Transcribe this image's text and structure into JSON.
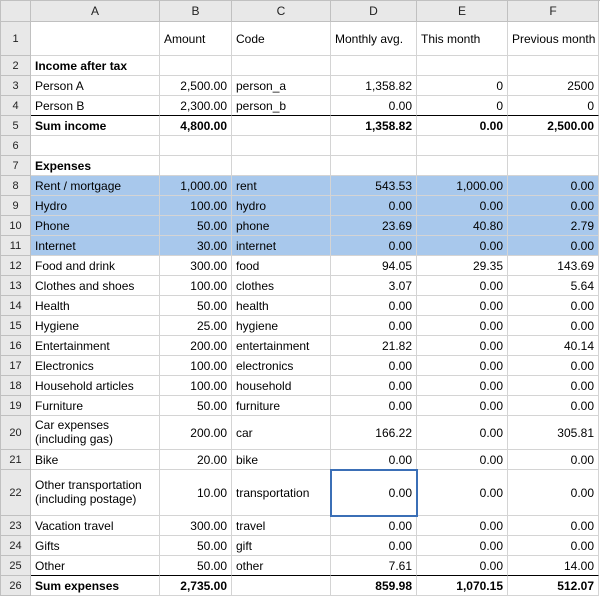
{
  "columns": [
    "",
    "A",
    "B",
    "C",
    "D",
    "E",
    "F"
  ],
  "row1": {
    "A": "",
    "B": "Amount",
    "C": "Code",
    "D": "Monthly avg.",
    "E": "This month",
    "F": "Previous month"
  },
  "rows": [
    {
      "n": "2",
      "A": "Income after tax",
      "B": "",
      "C": "",
      "D": "",
      "E": "",
      "F": "",
      "bold": true,
      "aBold": true
    },
    {
      "n": "3",
      "A": "Person A",
      "B": "2,500.00",
      "C": "person_a",
      "D": "1,358.82",
      "E": "0",
      "F": "2500"
    },
    {
      "n": "4",
      "A": "Person B",
      "B": "2,300.00",
      "C": "person_b",
      "D": "0.00",
      "E": "0",
      "F": "0",
      "bb": true
    },
    {
      "n": "5",
      "A": "Sum income",
      "B": "4,800.00",
      "C": "",
      "D": "1,358.82",
      "E": "0.00",
      "F": "2,500.00",
      "bold": true,
      "aBold": true
    },
    {
      "n": "6",
      "A": "",
      "B": "",
      "C": "",
      "D": "",
      "E": "",
      "F": ""
    },
    {
      "n": "7",
      "A": "Expenses",
      "B": "",
      "C": "",
      "D": "",
      "E": "",
      "F": "",
      "aBold": true
    },
    {
      "n": "8",
      "A": "Rent / mortgage",
      "B": "1,000.00",
      "C": "rent",
      "D": "543.53",
      "E": "1,000.00",
      "F": "0.00",
      "sel": true
    },
    {
      "n": "9",
      "A": "Hydro",
      "B": "100.00",
      "C": "hydro",
      "D": "0.00",
      "E": "0.00",
      "F": "0.00",
      "sel": true
    },
    {
      "n": "10",
      "A": "Phone",
      "B": "50.00",
      "C": "phone",
      "D": "23.69",
      "E": "40.80",
      "F": "2.79",
      "sel": true
    },
    {
      "n": "11",
      "A": "Internet",
      "B": "30.00",
      "C": "internet",
      "D": "0.00",
      "E": "0.00",
      "F": "0.00",
      "sel": true
    },
    {
      "n": "12",
      "A": "Food and drink",
      "B": "300.00",
      "C": "food",
      "D": "94.05",
      "E": "29.35",
      "F": "143.69"
    },
    {
      "n": "13",
      "A": "Clothes and shoes",
      "B": "100.00",
      "C": "clothes",
      "D": "3.07",
      "E": "0.00",
      "F": "5.64"
    },
    {
      "n": "14",
      "A": "Health",
      "B": "50.00",
      "C": "health",
      "D": "0.00",
      "E": "0.00",
      "F": "0.00"
    },
    {
      "n": "15",
      "A": "Hygiene",
      "B": "25.00",
      "C": "hygiene",
      "D": "0.00",
      "E": "0.00",
      "F": "0.00"
    },
    {
      "n": "16",
      "A": "Entertainment",
      "B": "200.00",
      "C": "entertainment",
      "D": "21.82",
      "E": "0.00",
      "F": "40.14"
    },
    {
      "n": "17",
      "A": "Electronics",
      "B": "100.00",
      "C": "electronics",
      "D": "0.00",
      "E": "0.00",
      "F": "0.00"
    },
    {
      "n": "18",
      "A": "Household articles",
      "B": "100.00",
      "C": "household",
      "D": "0.00",
      "E": "0.00",
      "F": "0.00"
    },
    {
      "n": "19",
      "A": "Furniture",
      "B": "50.00",
      "C": "furniture",
      "D": "0.00",
      "E": "0.00",
      "F": "0.00"
    },
    {
      "n": "20",
      "A": "Car expenses (including gas)",
      "B": "200.00",
      "C": "car",
      "D": "166.22",
      "E": "0.00",
      "F": "305.81",
      "tall": 1
    },
    {
      "n": "21",
      "A": "Bike",
      "B": "20.00",
      "C": "bike",
      "D": "0.00",
      "E": "0.00",
      "F": "0.00"
    },
    {
      "n": "22",
      "A": "Other transportation (including postage)",
      "B": "10.00",
      "C": "transportation",
      "D": "0.00",
      "E": "0.00",
      "F": "0.00",
      "tall": 2,
      "activeD": true
    },
    {
      "n": "23",
      "A": "Vacation travel",
      "B": "300.00",
      "C": "travel",
      "D": "0.00",
      "E": "0.00",
      "F": "0.00"
    },
    {
      "n": "24",
      "A": "Gifts",
      "B": "50.00",
      "C": "gift",
      "D": "0.00",
      "E": "0.00",
      "F": "0.00"
    },
    {
      "n": "25",
      "A": "Other",
      "B": "50.00",
      "C": "other",
      "D": "7.61",
      "E": "0.00",
      "F": "14.00",
      "bb": true
    },
    {
      "n": "26",
      "A": "Sum expenses",
      "B": "2,735.00",
      "C": "",
      "D": "859.98",
      "E": "1,070.15",
      "F": "512.07",
      "bold": true,
      "aBold": true
    }
  ],
  "chart_data": {
    "type": "table",
    "title": "",
    "columns": [
      "",
      "Amount",
      "Code",
      "Monthly avg.",
      "This month",
      "Previous month"
    ],
    "rows": [
      [
        "Income after tax",
        "",
        "",
        "",
        "",
        ""
      ],
      [
        "Person A",
        2500.0,
        "person_a",
        1358.82,
        0,
        2500
      ],
      [
        "Person B",
        2300.0,
        "person_b",
        0.0,
        0,
        0
      ],
      [
        "Sum income",
        4800.0,
        "",
        1358.82,
        0.0,
        2500.0
      ],
      [
        "",
        "",
        "",
        "",
        "",
        ""
      ],
      [
        "Expenses",
        "",
        "",
        "",
        "",
        ""
      ],
      [
        "Rent / mortgage",
        1000.0,
        "rent",
        543.53,
        1000.0,
        0.0
      ],
      [
        "Hydro",
        100.0,
        "hydro",
        0.0,
        0.0,
        0.0
      ],
      [
        "Phone",
        50.0,
        "phone",
        23.69,
        40.8,
        2.79
      ],
      [
        "Internet",
        30.0,
        "internet",
        0.0,
        0.0,
        0.0
      ],
      [
        "Food and drink",
        300.0,
        "food",
        94.05,
        29.35,
        143.69
      ],
      [
        "Clothes and shoes",
        100.0,
        "clothes",
        3.07,
        0.0,
        5.64
      ],
      [
        "Health",
        50.0,
        "health",
        0.0,
        0.0,
        0.0
      ],
      [
        "Hygiene",
        25.0,
        "hygiene",
        0.0,
        0.0,
        0.0
      ],
      [
        "Entertainment",
        200.0,
        "entertainment",
        21.82,
        0.0,
        40.14
      ],
      [
        "Electronics",
        100.0,
        "electronics",
        0.0,
        0.0,
        0.0
      ],
      [
        "Household articles",
        100.0,
        "household",
        0.0,
        0.0,
        0.0
      ],
      [
        "Furniture",
        50.0,
        "furniture",
        0.0,
        0.0,
        0.0
      ],
      [
        "Car expenses (including gas)",
        200.0,
        "car",
        166.22,
        0.0,
        305.81
      ],
      [
        "Bike",
        20.0,
        "bike",
        0.0,
        0.0,
        0.0
      ],
      [
        "Other transportation (including postage)",
        10.0,
        "transportation",
        0.0,
        0.0,
        0.0
      ],
      [
        "Vacation travel",
        300.0,
        "travel",
        0.0,
        0.0,
        0.0
      ],
      [
        "Gifts",
        50.0,
        "gift",
        0.0,
        0.0,
        0.0
      ],
      [
        "Other",
        50.0,
        "other",
        7.61,
        0.0,
        14.0
      ],
      [
        "Sum expenses",
        2735.0,
        "",
        859.98,
        1070.15,
        512.07
      ]
    ]
  }
}
